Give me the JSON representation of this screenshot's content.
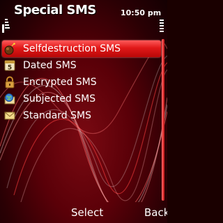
{
  "header": {
    "title": "Special SMS",
    "clock": "10:50 pm"
  },
  "menu": {
    "items": [
      {
        "label": "Selfdestruction SMS",
        "icon": "bomb-icon",
        "selected": true
      },
      {
        "label": "Dated SMS",
        "icon": "calendar-icon",
        "selected": false
      },
      {
        "label": "Encrypted SMS",
        "icon": "lock-icon",
        "selected": false
      },
      {
        "label": "Subjected SMS",
        "icon": "globe-envelope-icon",
        "selected": false
      },
      {
        "label": "Standard SMS",
        "icon": "envelope-icon",
        "selected": false
      }
    ]
  },
  "softkeys": {
    "left": "Select",
    "right": "Back"
  },
  "colors": {
    "background": "#5a0008",
    "highlight": "#e01818",
    "text": "#ffffff"
  }
}
